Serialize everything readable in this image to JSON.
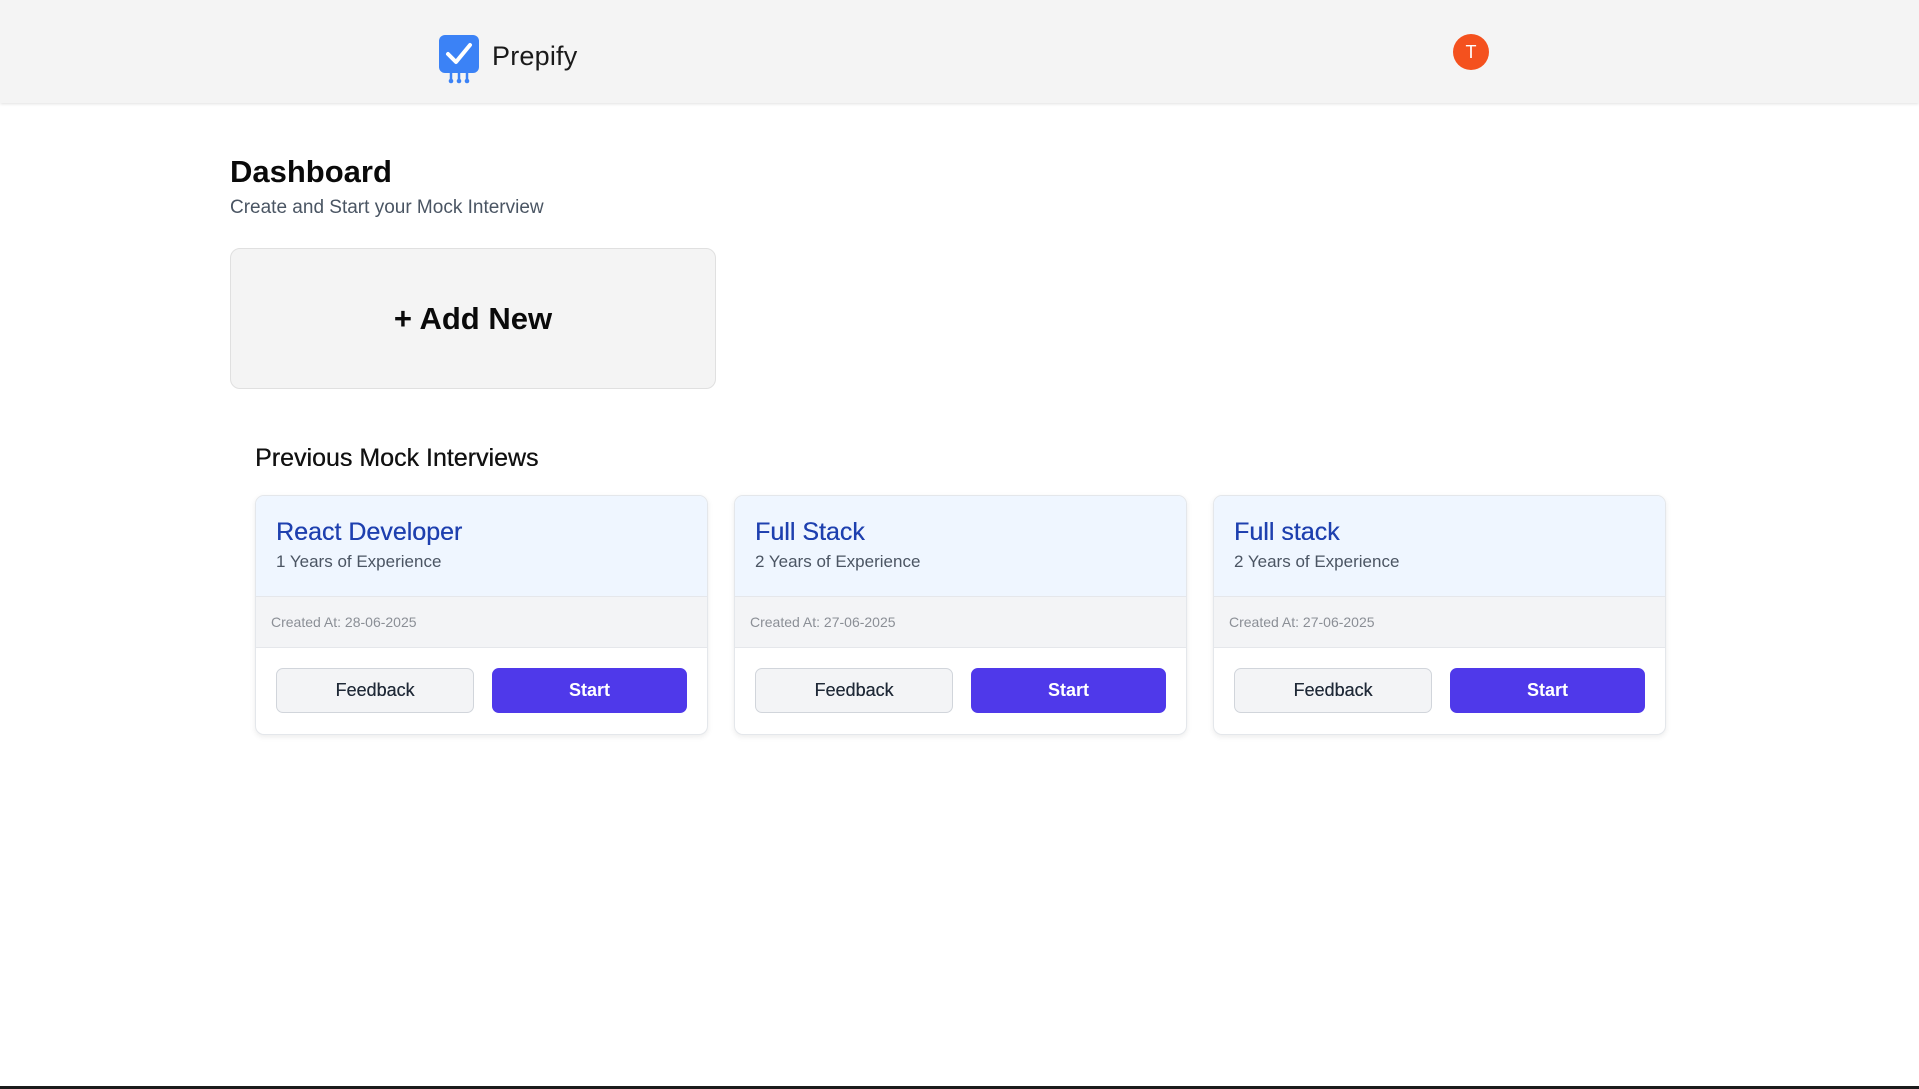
{
  "header": {
    "app_name": "Prepify",
    "avatar_initial": "T",
    "avatar_color": "#f4511e",
    "logo_icon": "checkbox-robot-icon"
  },
  "dashboard": {
    "title": "Dashboard",
    "subtitle": "Create and Start your Mock Interview",
    "add_new_label": "+ Add New"
  },
  "previous": {
    "title": "Previous Mock Interviews",
    "cards": [
      {
        "role": "React Developer",
        "experience": "1 Years of Experience",
        "created": "Created At: 28-06-2025",
        "feedback_label": "Feedback",
        "start_label": "Start"
      },
      {
        "role": "Full Stack",
        "experience": "2 Years of Experience",
        "created": "Created At: 27-06-2025",
        "feedback_label": "Feedback",
        "start_label": "Start"
      },
      {
        "role": "Full stack",
        "experience": "2 Years of Experience",
        "created": "Created At: 27-06-2025",
        "feedback_label": "Feedback",
        "start_label": "Start"
      }
    ]
  },
  "colors": {
    "accent": "#4f39ea",
    "card_title": "#1e40af",
    "logo_blue": "#3b82f6"
  }
}
